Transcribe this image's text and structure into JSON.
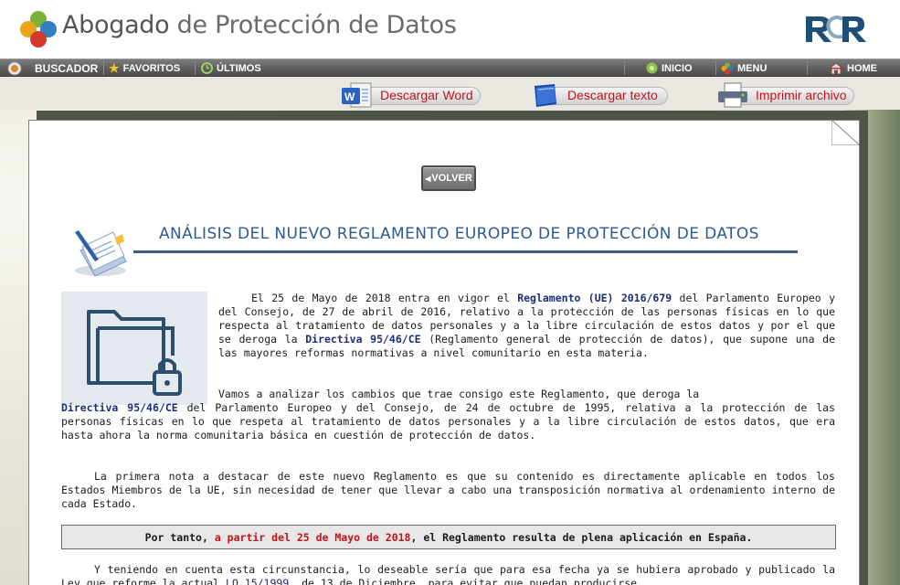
{
  "header": {
    "title_part1": "Abogado",
    "title_part2": " de Protección de Datos"
  },
  "navbar": {
    "buscador": "BUSCADOR",
    "favoritos": "FAVORITOS",
    "ultimos": "ÚLTIMOS",
    "inicio": "INICIO",
    "menu": "MENU",
    "home": "HOME"
  },
  "actions": {
    "word": "Descargar Word",
    "texto": "Descargar texto",
    "imprimir": "Imprimir archivo"
  },
  "doc": {
    "volver": "VOLVER",
    "title": "ANÁLISIS DEL NUEVO REGLAMENTO EUROPEO DE PROTECCIÓN DE DATOS",
    "p1_a": "El 25 de Mayo de 2018 entra en vigor el ",
    "p1_link1": "Reglamento (UE) 2016/679",
    "p1_b": " del Parlamento Europeo y del Consejo, de 27 de abril de 2016, relativo a la protección de las personas físicas en lo que respecta al tratamiento de datos personales y a la libre circulación de estos datos y por el que se deroga la ",
    "p1_link2": "Directiva 95/46/CE",
    "p1_c": " (Reglamento general de protección de datos), que supone una de las mayores reformas normativas a nivel comunitario en esta materia.",
    "p2_a": "Vamos a analizar los cambios que trae consigo este Reglamento, que deroga la",
    "p2_link": "Directiva 95/46/CE",
    "p2_b": " del Parlamento Europeo y del Consejo, de 24 de octubre de 1995, relativa a la protección de las personas físicas en lo que respeta al tratamiento de datos personales y a la libre circulación de estos datos, que era hasta ahora la norma comunitaria básica en cuestión de protección de datos.",
    "p3": "La primera nota a destacar de este nuevo Reglamento es que su contenido es directamente aplicable en todos los Estados Miembros de la UE, sin necesidad de tener que llevar a cabo una transposición normativa al ordenamiento interno de cada Estado.",
    "box_a": "Por tanto, ",
    "box_red": "a partir del 25 de Mayo de 2018",
    "box_b": ", el Reglamento resulta de plena aplicación en España.",
    "p5_a": "Y teniendo en cuenta esta circunstancia, lo deseable sería que para esa fecha ya se hubiera aprobado y publicado la Ley que reforme la actual ",
    "p5_link": "LO 15/1999",
    "p5_b": ", de 13 de Diciembre, para evitar que puedan producirse"
  },
  "colors": {
    "title_blue": "#2b5a97",
    "link_navy": "#1d2c7a",
    "accent_red": "#c0141c"
  }
}
